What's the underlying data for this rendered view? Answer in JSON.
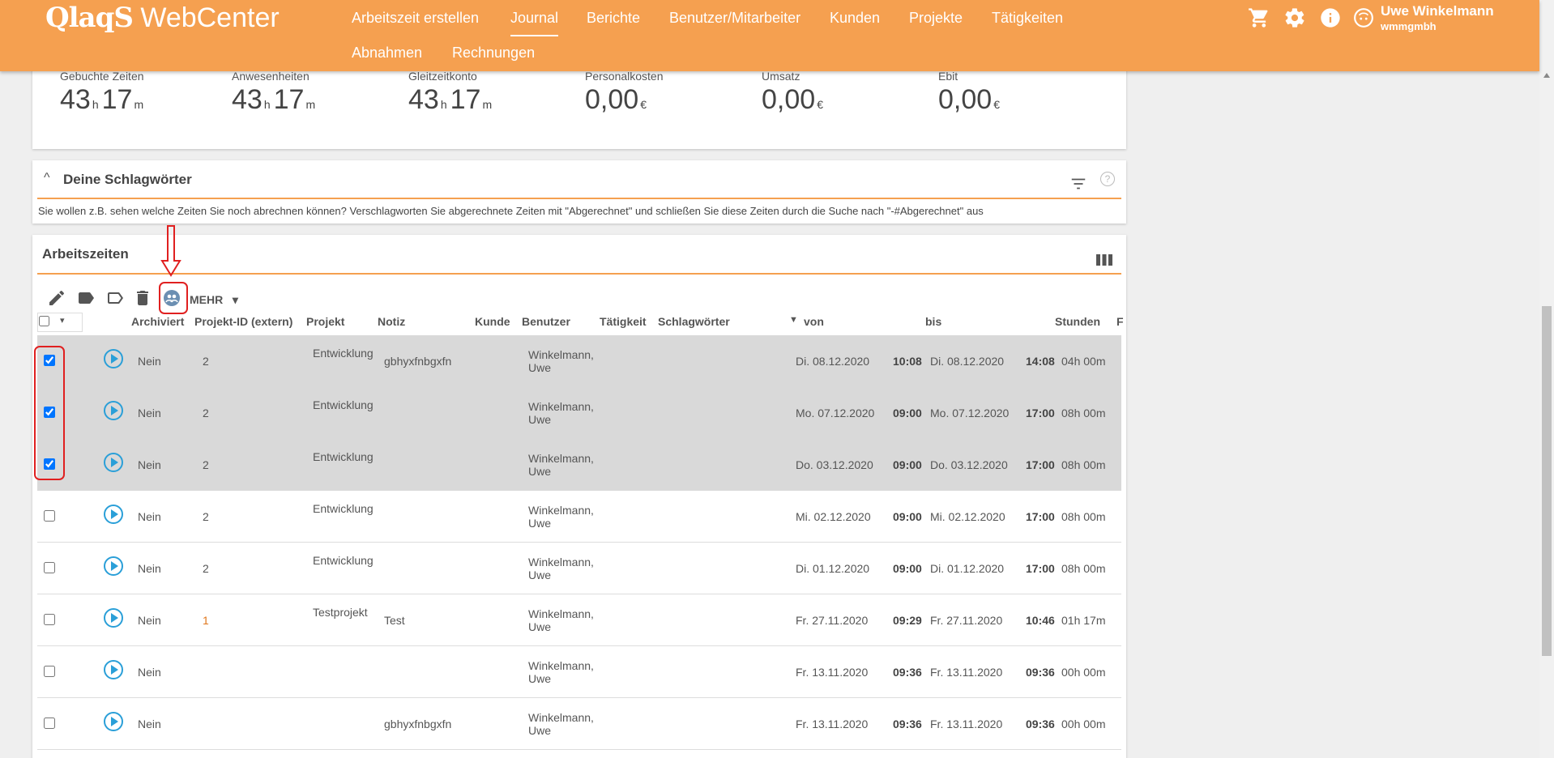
{
  "header": {
    "logo_brand": "QlaqS",
    "logo_sub": " WebCenter",
    "nav": [
      "Arbeitszeit erstellen",
      "Journal",
      "Berichte",
      "Benutzer/Mitarbeiter",
      "Kunden",
      "Projekte",
      "Tätigkeiten",
      "Abnahmen",
      "Rechnungen"
    ],
    "active_nav": "Journal",
    "user_name": "Uwe Winkelmann",
    "user_org": "wmmgmbh",
    "icons": [
      "cart-icon",
      "gear-icon",
      "info-icon",
      "avatar-icon"
    ]
  },
  "stats": [
    {
      "label": "Gebuchte Zeiten",
      "value": "43",
      "unit1": "h",
      "value2": "17",
      "unit2": "m"
    },
    {
      "label": "Anwesenheiten",
      "value": "43",
      "unit1": "h",
      "value2": "17",
      "unit2": "m"
    },
    {
      "label": "Gleitzeitkonto",
      "value": "43",
      "unit1": "h",
      "value2": "17",
      "unit2": "m"
    },
    {
      "label": "Personalkosten",
      "value": "0,00",
      "unit1": "€",
      "value2": "",
      "unit2": ""
    },
    {
      "label": "Umsatz",
      "value": "0,00",
      "unit1": "€",
      "value2": "",
      "unit2": ""
    },
    {
      "label": "Ebit",
      "value": "0,00",
      "unit1": "€",
      "value2": "",
      "unit2": ""
    }
  ],
  "tags": {
    "title": "Deine Schlagwörter",
    "chevron": "^",
    "help": "?",
    "text": "Sie wollen z.B. sehen welche Zeiten Sie noch abrechnen können? Verschlagworten Sie abgerechnete Zeiten mit \"Abgerechnet\" und schließen Sie diese Zeiten durch die Suche nach \"-#Abgerechnet\" aus"
  },
  "work": {
    "title": "Arbeitszeiten",
    "mehr_label": "MEHR",
    "columns": [
      "Archiviert",
      "Projekt-ID (extern)",
      "Projekt",
      "Notiz",
      "Kunde",
      "Benutzer",
      "Tätigkeit",
      "Schlagwörter",
      "von",
      "bis",
      "Stunden",
      "F"
    ],
    "rows": [
      {
        "checked": true,
        "archiviert": "Nein",
        "projekt_id": "2",
        "projekt": "Entwicklung",
        "notiz": "gbhyxfnbgxfn",
        "benutzer": "Winkelmann, Uwe",
        "von_date": "Di. 08.12.2020",
        "von_time": "10:08",
        "bis_date": "Di. 08.12.2020",
        "bis_time": "14:08",
        "stunden": "04h 00m"
      },
      {
        "checked": true,
        "archiviert": "Nein",
        "projekt_id": "2",
        "projekt": "Entwicklung",
        "notiz": "",
        "benutzer": "Winkelmann, Uwe",
        "von_date": "Mo. 07.12.2020",
        "von_time": "09:00",
        "bis_date": "Mo. 07.12.2020",
        "bis_time": "17:00",
        "stunden": "08h 00m"
      },
      {
        "checked": true,
        "archiviert": "Nein",
        "projekt_id": "2",
        "projekt": "Entwicklung",
        "notiz": "",
        "benutzer": "Winkelmann, Uwe",
        "von_date": "Do. 03.12.2020",
        "von_time": "09:00",
        "bis_date": "Do. 03.12.2020",
        "bis_time": "17:00",
        "stunden": "08h 00m"
      },
      {
        "checked": false,
        "archiviert": "Nein",
        "projekt_id": "2",
        "projekt": "Entwicklung",
        "notiz": "",
        "benutzer": "Winkelmann, Uwe",
        "von_date": "Mi. 02.12.2020",
        "von_time": "09:00",
        "bis_date": "Mi. 02.12.2020",
        "bis_time": "17:00",
        "stunden": "08h 00m"
      },
      {
        "checked": false,
        "archiviert": "Nein",
        "projekt_id": "2",
        "projekt": "Entwicklung",
        "notiz": "",
        "benutzer": "Winkelmann, Uwe",
        "von_date": "Di. 01.12.2020",
        "von_time": "09:00",
        "bis_date": "Di. 01.12.2020",
        "bis_time": "17:00",
        "stunden": "08h 00m"
      },
      {
        "checked": false,
        "archiviert": "Nein",
        "projekt_id": "1",
        "projekt": "Testprojekt",
        "notiz": "Test",
        "benutzer": "Winkelmann, Uwe",
        "von_date": "Fr. 27.11.2020",
        "von_time": "09:29",
        "bis_date": "Fr. 27.11.2020",
        "bis_time": "10:46",
        "stunden": "01h 17m"
      },
      {
        "checked": false,
        "archiviert": "Nein",
        "projekt_id": "",
        "projekt": "",
        "notiz": "",
        "benutzer": "Winkelmann, Uwe",
        "von_date": "Fr. 13.11.2020",
        "von_time": "09:36",
        "bis_date": "Fr. 13.11.2020",
        "bis_time": "09:36",
        "stunden": "00h 00m"
      },
      {
        "checked": false,
        "archiviert": "Nein",
        "projekt_id": "",
        "projekt": "",
        "notiz": "gbhyxfnbgxfn",
        "benutzer": "Winkelmann, Uwe",
        "von_date": "Fr. 13.11.2020",
        "von_time": "09:36",
        "bis_date": "Fr. 13.11.2020",
        "bis_time": "09:36",
        "stunden": "00h 00m"
      }
    ]
  },
  "colors": {
    "accent": "#f5a050",
    "selected_row": "#d9d9d9",
    "play": "#2a9fd8",
    "annotation": "#e02020"
  }
}
